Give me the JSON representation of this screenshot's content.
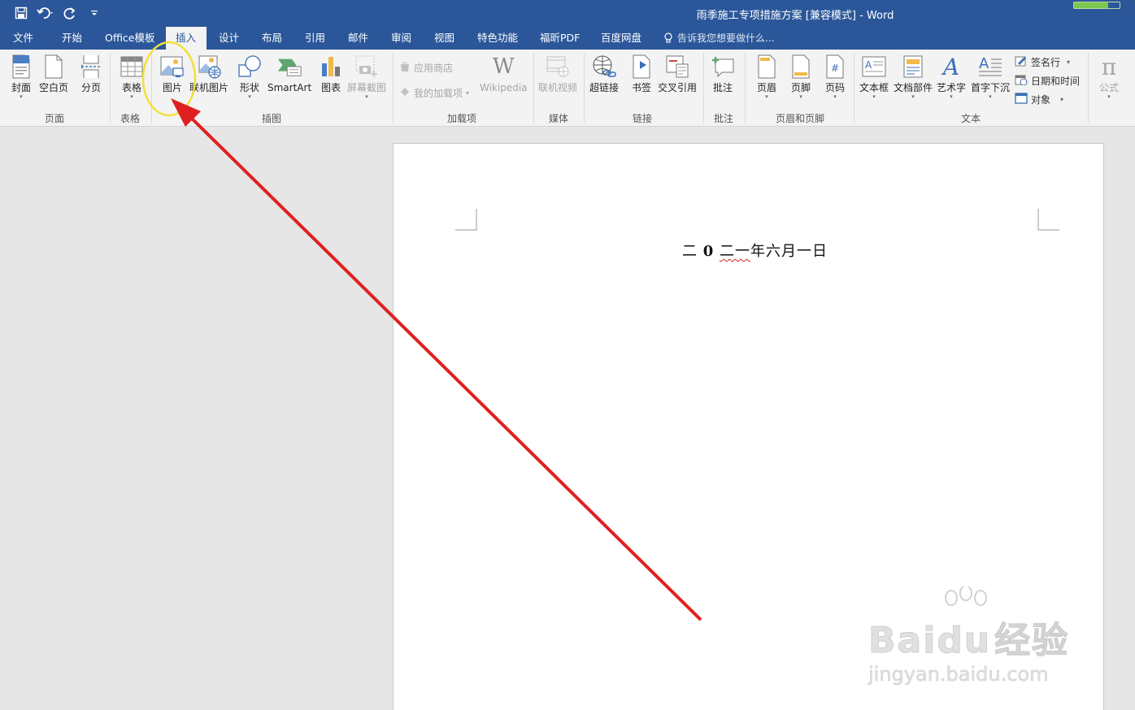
{
  "window": {
    "title": "雨季施工专项措施方案 [兼容模式] - Word",
    "battery_level": 0.75
  },
  "tabs": [
    "文件",
    "开始",
    "Office模板",
    "插入",
    "设计",
    "布局",
    "引用",
    "邮件",
    "审阅",
    "视图",
    "特色功能",
    "福昕PDF",
    "百度网盘"
  ],
  "active_tab": "插入",
  "tell_me": "告诉我您想要做什么...",
  "ribbon": {
    "pages": {
      "cover": "封面",
      "blank": "空白页",
      "break": "分页",
      "group": "页面"
    },
    "tables": {
      "table": "表格",
      "group": "表格"
    },
    "illustrations": {
      "picture": "图片",
      "online_picture": "联机图片",
      "shapes": "形状",
      "smartart": "SmartArt",
      "chart": "图表",
      "screenshot": "屏幕截图",
      "group": "插图"
    },
    "addins": {
      "store": "应用商店",
      "my_addins": "我的加载项",
      "wikipedia": "Wikipedia",
      "group": "加载项"
    },
    "media": {
      "online_video": "联机视频",
      "group": "媒体"
    },
    "links": {
      "hyperlink": "超链接",
      "bookmark": "书签",
      "cross_ref": "交叉引用",
      "group": "链接"
    },
    "comments": {
      "comment": "批注",
      "group": "批注"
    },
    "header_footer": {
      "header": "页眉",
      "footer": "页脚",
      "page_number": "页码",
      "group": "页眉和页脚"
    },
    "text": {
      "textbox": "文本框",
      "quick_parts": "文档部件",
      "wordart": "艺术字",
      "dropcap": "首字下沉",
      "signature": "签名行",
      "datetime": "日期和时间",
      "object": "对象",
      "group": "文本"
    },
    "symbols": {
      "equation": "公式"
    }
  },
  "document": {
    "text_parts": [
      "二",
      "0",
      "二一",
      "年六月一日"
    ]
  },
  "watermark": {
    "brand": "Bai",
    "brand2": "du",
    "label": "经验",
    "url": "jingyan.baidu.com"
  },
  "colors": {
    "accent": "#2b579a",
    "annotation_arrow": "#e02020",
    "highlight_circle": "#f2e03a"
  }
}
